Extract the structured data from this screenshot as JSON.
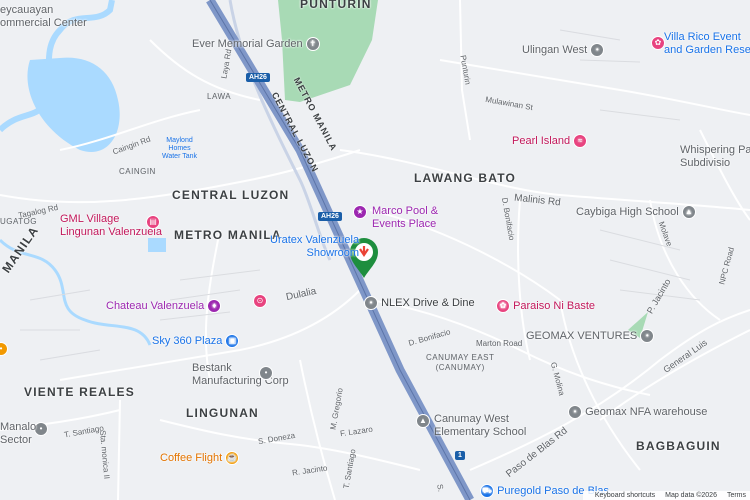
{
  "areas": {
    "punturin": "PUNTURIN",
    "lawang_bato": "LAWANG BATO",
    "central_luzon_area": "CENTRAL LUZON",
    "metro_manila_area": "METRO MANILA",
    "caingin": "CAINGIN",
    "lawa": "LAWA",
    "viente_reales": "VIENTE REALES",
    "lingunan": "LINGUNAN",
    "bagbaguin": "BAGBAGUIN",
    "canumay_east": "CANUMAY EAST\n(CANUMAY)",
    "manila_left": "MANILA",
    "ugatog": "UGATOG"
  },
  "roads": {
    "metro_manila": "METRO MANILA",
    "central_luzon": "CENTRAL LUZON",
    "malinis_rd": "Malinis Rd",
    "mulawinan_st": "Mulawinan St",
    "punturin_rd": "Punturin",
    "d_bonifacio_1": "D. Bonifacio",
    "d_bonifacio_2": "D. Bonifacio",
    "marton_road": "Marton Road",
    "dulalia": "Dulalia",
    "paso_de_blas_rd": "Paso de Blas Rd",
    "general_luis": "General Luis",
    "p_jacinto": "P. Jacinto",
    "t_santiago_1": "T. Santiago",
    "t_santiago_2": "T. Santiago",
    "m_gregorio": "M. Gregorio",
    "f_lazaro": "F. Lazaro",
    "s_doneza": "S. Doneza",
    "r_jacinto": "R. Jacinto",
    "g_molina": "G. Molina",
    "caingin_rd": "Caingin Rd",
    "tagalog_rd": "Tagalog Rd",
    "molave": "Molave",
    "npc_road": "NPC Road",
    "laya_rd": "Laya Rd",
    "sta_monica": "Sta. monica II",
    "s_santiago": "S."
  },
  "shields": [
    "AH26",
    "AH26",
    "1"
  ],
  "pois": {
    "ever_memorial": "Ever Memorial Garden",
    "ulingan_west": "Ulingan West",
    "villa_rico": "Villa Rico Event\nand Garden Rese",
    "pearl_island": "Pearl Island",
    "whispering": "Whispering Paln\nSubdivisio",
    "marco_pool": "Marco Pool &\nEvents Place",
    "caybiga": "Caybiga High School",
    "uratex": "Uratex Valenzuela\nShowroom",
    "gml_village": "GML Village\nLingunan Valenzuela",
    "maylond": "Maylond\nHomes\nWater Tank",
    "chateau": "Chateau Valenzuela",
    "nlex": "NLEX Drive & Dine",
    "paraiso": "Paraiso Ni Baste",
    "geomax_ventures": "GEOMAX VENTURES",
    "sky360": "Sky 360 Plaza",
    "bestank": "Bestank\nManufacturing Corp",
    "geomax_nfa": "Geomax NFA warehouse",
    "canumay_school": "Canumay West\nElementary School",
    "coffee_flight": "Coffee Flight",
    "puregold": "Puregold Paso de Blas",
    "manalo_sector": "Manalo\nSector",
    "meycauayan": "eycauayan\nommercial Center"
  },
  "attribution": {
    "shortcuts": "Keyboard shortcuts",
    "map_data": "Map data ©2026",
    "terms": "Terms"
  },
  "colors": {
    "water": "#aadaff",
    "highway": "#7f97c8",
    "park": "#a8dab5",
    "pin": "#1e8e3e",
    "pin_arrow": "#ea4335"
  }
}
